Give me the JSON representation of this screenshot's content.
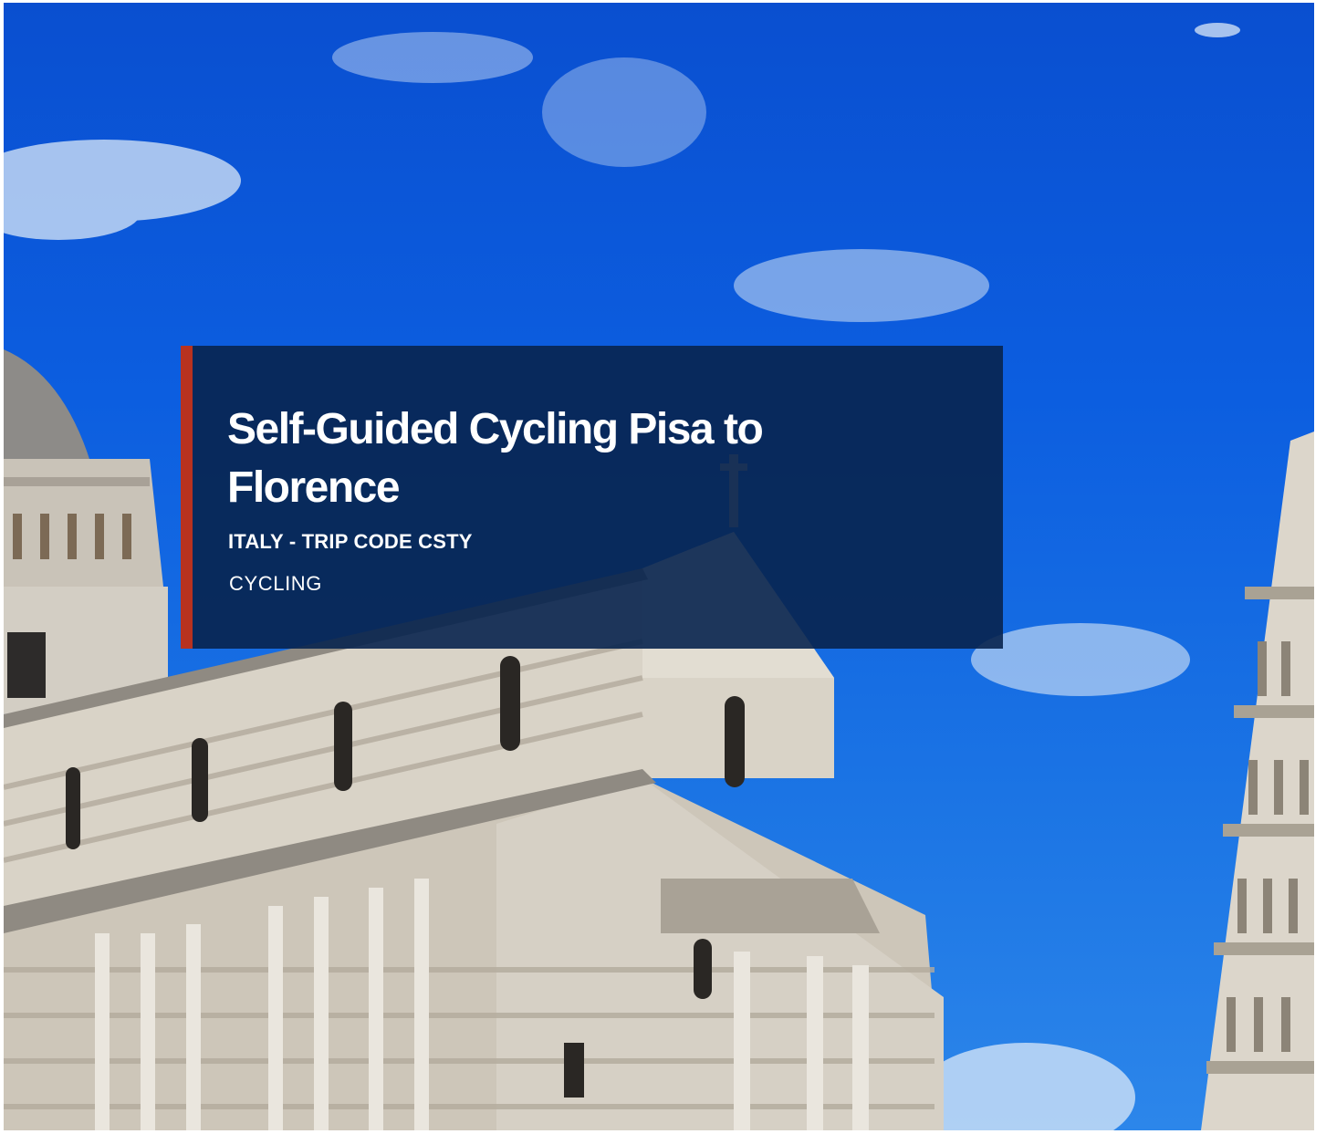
{
  "hero": {
    "image_subject": "Pisa Cathedral and Leaning Tower under blue sky",
    "title": "Self-Guided Cycling Pisa to Florence",
    "subtitle": "ITALY - TRIP CODE CSTY",
    "category": "CYCLING"
  },
  "colors": {
    "panel_background": "#08234e",
    "accent_bar": "#b8321f",
    "sky": "#0c5ee0",
    "text": "#ffffff"
  }
}
